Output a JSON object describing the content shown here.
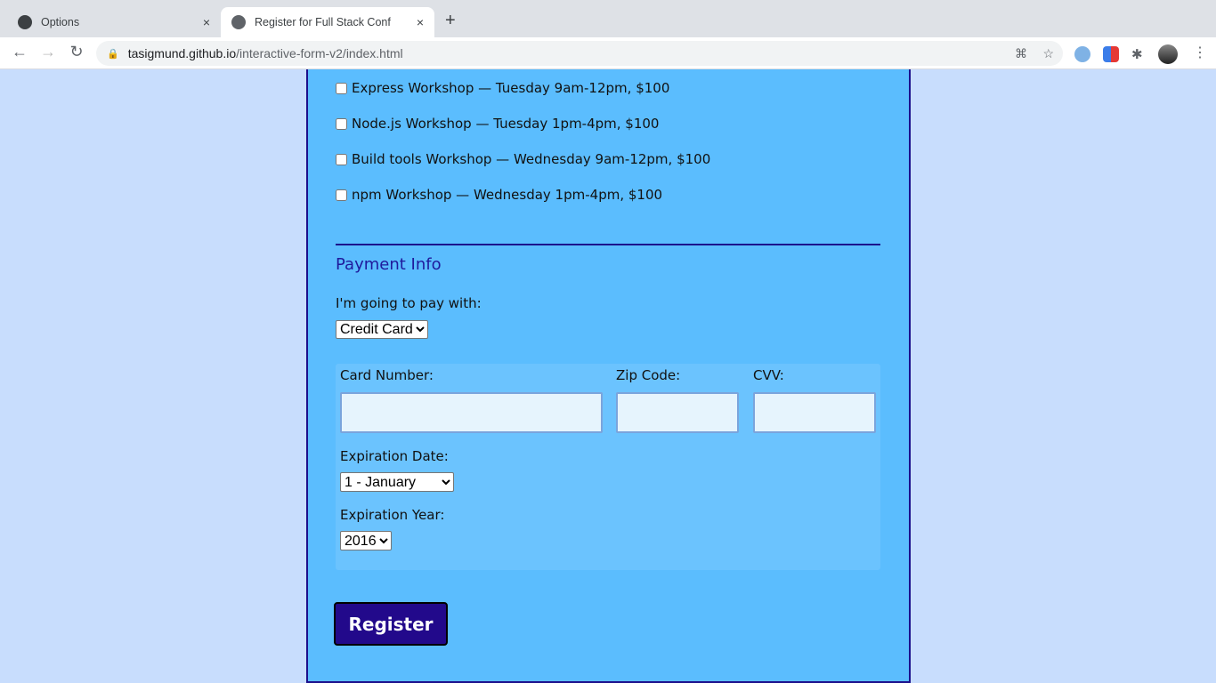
{
  "browser": {
    "tabs": [
      {
        "label": "Options",
        "icon": "github-icon"
      },
      {
        "label": "Register for Full Stack Conf",
        "icon": "globe-icon"
      }
    ],
    "new_tab": "+",
    "close": "×",
    "url_host": "tasigmund.github.io",
    "url_path": "/interactive-form-v2/index.html"
  },
  "activities": [
    "Express Workshop — Tuesday 9am-12pm, $100",
    "Node.js Workshop — Tuesday 1pm-4pm, $100",
    "Build tools Workshop — Wednesday 9am-12pm, $100",
    "npm Workshop — Wednesday 1pm-4pm, $100"
  ],
  "payment": {
    "heading": "Payment Info",
    "pay_label": "I'm going to pay with:",
    "pay_value": "Credit Card",
    "card_label": "Card Number:",
    "zip_label": "Zip Code:",
    "cvv_label": "CVV:",
    "exp_date_label": "Expiration Date:",
    "exp_date_value": "1 - January",
    "exp_year_label": "Expiration Year:",
    "exp_year_value": "2016"
  },
  "register": "Register"
}
